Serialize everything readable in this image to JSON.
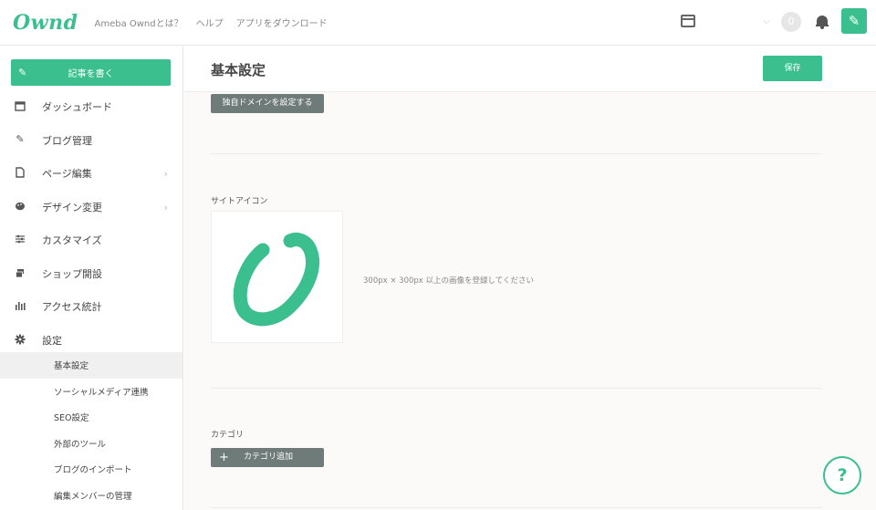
{
  "header": {
    "logo": "Ownd",
    "nav": [
      "Ameba Owndとは？",
      "ヘルプ",
      "アプリをダウンロード"
    ],
    "avatar_initial": "0",
    "icons": {
      "preview": "browser-window-icon",
      "dropdown": "chevron-down-icon",
      "notifications": "bell-icon",
      "new_post": "edit-icon"
    }
  },
  "sidebar": {
    "write_button": "記事を書く",
    "items": [
      {
        "label": "ダッシュボード",
        "icon": "calendar-icon",
        "has_arrow": false
      },
      {
        "label": "ブログ管理",
        "icon": "edit-icon",
        "has_arrow": false
      },
      {
        "label": "ページ編集",
        "icon": "page-icon",
        "has_arrow": true
      },
      {
        "label": "デザイン変更",
        "icon": "palette-icon",
        "has_arrow": true
      },
      {
        "label": "カスタマイズ",
        "icon": "sliders-icon",
        "has_arrow": false
      },
      {
        "label": "ショップ開設",
        "icon": "shop-icon",
        "has_arrow": false
      },
      {
        "label": "アクセス統計",
        "icon": "bar-chart-icon",
        "has_arrow": false
      },
      {
        "label": "設定",
        "icon": "gear-icon",
        "has_arrow": false
      }
    ],
    "sub_items": [
      {
        "label": "基本設定",
        "active": true
      },
      {
        "label": "ソーシャルメディア連携",
        "active": false
      },
      {
        "label": "SEO設定",
        "active": false
      },
      {
        "label": "外部のツール",
        "active": false
      },
      {
        "label": "ブログのインポート",
        "active": false
      },
      {
        "label": "編集メンバーの管理",
        "active": false
      }
    ]
  },
  "main": {
    "title": "基本設定",
    "save_button": "保存",
    "domain_button": "独自ドメインを設定する",
    "site_icon": {
      "label": "サイトアイコン",
      "note": "300px × 300px 以上の画像を登録してください"
    },
    "category": {
      "label": "カテゴリ",
      "add_button": "カテゴリ追加"
    }
  },
  "help_button": "?",
  "colors": {
    "brand": "#3bbf8f",
    "dark_button": "#6f7b78",
    "background": "#fbfaf9"
  }
}
